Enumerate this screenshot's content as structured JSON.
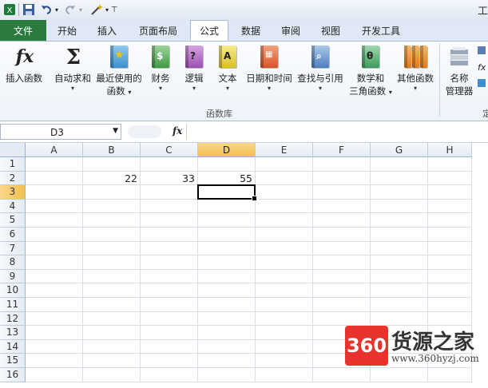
{
  "quick_access": {
    "title_fragment": "工"
  },
  "tabs": [
    {
      "label": "文件"
    },
    {
      "label": "开始"
    },
    {
      "label": "插入"
    },
    {
      "label": "页面布局"
    },
    {
      "label": "公式"
    },
    {
      "label": "数据"
    },
    {
      "label": "审阅"
    },
    {
      "label": "视图"
    },
    {
      "label": "开发工具"
    }
  ],
  "ribbon": {
    "buttons": [
      {
        "label": "插入函数",
        "icon": "fx-icon"
      },
      {
        "label": "自动求和",
        "icon": "sigma-icon"
      },
      {
        "label": "最近使用的",
        "label2": "函数",
        "icon": "star-book-icon"
      },
      {
        "label": "财务",
        "icon": "finance-book-icon"
      },
      {
        "label": "逻辑",
        "icon": "logic-book-icon"
      },
      {
        "label": "文本",
        "icon": "text-book-icon"
      },
      {
        "label": "日期和时间",
        "icon": "date-book-icon"
      },
      {
        "label": "查找与引用",
        "icon": "lookup-book-icon"
      },
      {
        "label": "数学和",
        "label2": "三角函数",
        "icon": "math-book-icon"
      },
      {
        "label": "其他函数",
        "icon": "more-books-icon"
      },
      {
        "label": "名称",
        "label2": "管理器",
        "icon": "name-manager-icon"
      }
    ],
    "group_label": "函数库",
    "partial_label": "定"
  },
  "formula_bar": {
    "name_box": "D3",
    "fx_label": "fx",
    "formula": ""
  },
  "columns": [
    "A",
    "B",
    "C",
    "D",
    "E",
    "F",
    "G",
    "H"
  ],
  "rows": [
    "1",
    "2",
    "3",
    "4",
    "5",
    "6",
    "7",
    "8",
    "9",
    "10",
    "11",
    "12",
    "13",
    "14",
    "15",
    "16"
  ],
  "cells": {
    "B2": "22",
    "C2": "33",
    "D2": "55"
  },
  "selected_column": "D",
  "selected_row": "3",
  "watermark": {
    "logo": "360",
    "title": "货源之家",
    "url": "www.360hyzj.com"
  }
}
